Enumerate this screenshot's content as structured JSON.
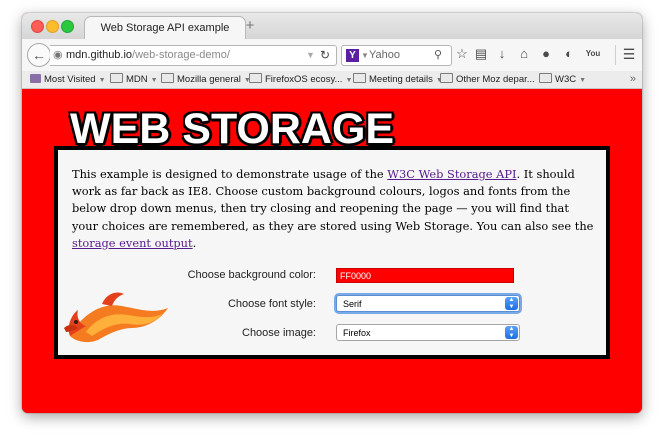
{
  "browser": {
    "tab_title": "Web Storage API example",
    "new_tab_symbol": "+",
    "url_host": "mdn.github.io",
    "url_path": "/web-storage-demo/",
    "search_placeholder": "Yahoo",
    "search_engine_letter": "Y"
  },
  "bookmarks": [
    {
      "label": "Most Visited"
    },
    {
      "label": "MDN"
    },
    {
      "label": "Mozilla general"
    },
    {
      "label": "FirefoxOS ecosy..."
    },
    {
      "label": "Meeting details"
    },
    {
      "label": "Other Moz depar..."
    },
    {
      "label": "W3C"
    }
  ],
  "page": {
    "title": "WEB STORAGE",
    "intro_before_link1": "This example is designed to demonstrate usage of the ",
    "link1": "W3C Web Storage API",
    "intro_middle": ". It should work as far back as IE8. Choose custom background colours, logos and fonts from the below drop down menus, then try closing and reopening the page — you will find that your choices are remembered, as they are stored using Web Storage. You can also see the ",
    "link2": "storage event output",
    "intro_end": ".",
    "form": {
      "bg_label": "Choose background color:",
      "bg_value": "FF0000",
      "font_label": "Choose font style:",
      "font_value": "Serif",
      "image_label": "Choose image:",
      "image_value": "Firefox"
    }
  },
  "colors": {
    "page_background": "#ff0000",
    "link": "#551a8b",
    "select_arrow": "#1f6fe0"
  },
  "icons": [
    "back-arrow-icon",
    "globe-icon",
    "reload-icon",
    "search-icon",
    "star-icon",
    "reading-list-icon",
    "download-icon",
    "home-icon",
    "chat-icon",
    "sync-icon",
    "youtube-icon",
    "menu-icon",
    "folder-icon",
    "firefox-logo"
  ]
}
